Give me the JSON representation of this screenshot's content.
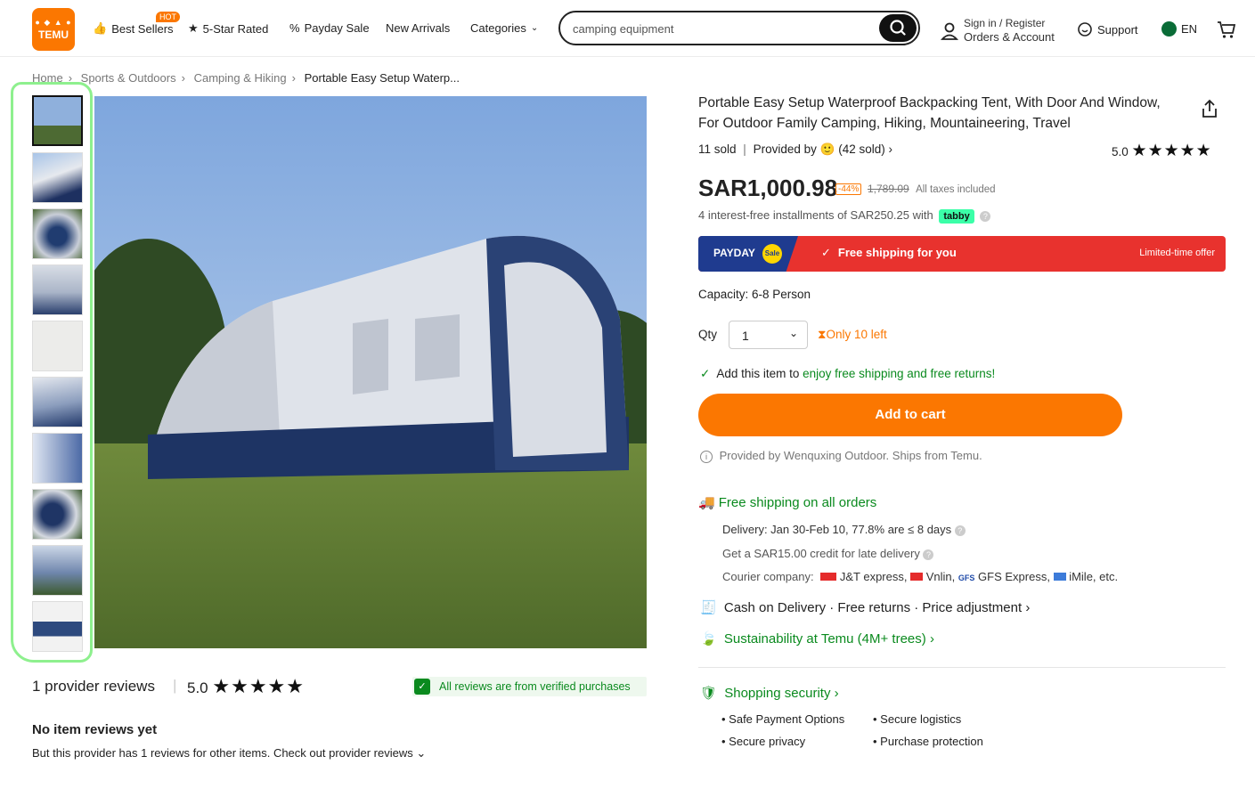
{
  "header": {
    "logo_top": "🛒TEMU",
    "logo_text": "TEMU",
    "hot_badge": "HOT",
    "nav": [
      "Best Sellers",
      "5-Star Rated",
      "Payday Sale",
      "New Arrivals",
      "Categories"
    ],
    "search_value": "camping equipment",
    "signin_line1": "Sign in / Register",
    "signin_line2": "Orders & Account",
    "support": "Support",
    "lang": "EN"
  },
  "breadcrumb": [
    "Home",
    "Sports & Outdoors",
    "Camping & Hiking",
    "Portable Easy Setup Waterp..."
  ],
  "product": {
    "title": "Portable Easy Setup Waterproof Backpacking Tent, With Door And Window, For Outdoor Family Camping, Hiking, Mountaineering, Travel",
    "sold": "11 sold",
    "provided_by": "Provided by",
    "provider_sold": "(42 sold)",
    "rating": "5.0",
    "price": "SAR1,000.98",
    "discount": "-44%",
    "old_price": "1,789.09",
    "taxes": "All taxes included",
    "installments": "4 interest-free installments of SAR250.25 with",
    "tabby": "tabby",
    "payday_label": "PAYDAY",
    "sale_label": "Sale",
    "free_shipping_banner": "Free shipping for you",
    "limited": "Limited-time offer",
    "capacity": "Capacity: 6-8 Person",
    "qty_label": "Qty",
    "qty_value": "1",
    "stock": "Only 10 left",
    "add_note_prefix": "Add this item to",
    "add_note_link": "enjoy free shipping and free returns!",
    "add_to_cart": "Add to cart",
    "provided_note": "Provided by Wenquxing Outdoor. Ships from Temu."
  },
  "shipping": {
    "title": "Free shipping on all orders",
    "delivery": "Delivery: Jan 30-Feb 10, 77.8% are ≤ 8 days",
    "credit": "Get a SAR15.00 credit for late delivery",
    "courier_label": "Courier company:",
    "couriers": [
      "J&T express,",
      "Vnlin,",
      "GFS Express,",
      "iMile, etc."
    ],
    "cod": "Cash on Delivery · Free returns · Price adjustment",
    "sustain": "Sustainability at Temu (4M+ trees)",
    "security_title": "Shopping security",
    "security_items": [
      "Safe Payment Options",
      "Secure logistics",
      "Secure privacy",
      "Purchase protection"
    ]
  },
  "reviews": {
    "count_label": "1 provider reviews",
    "rating": "5.0",
    "verified": "All reviews are from verified purchases",
    "none_title": "No item reviews yet",
    "none_text": "But this provider has 1 reviews for other items. Check out provider reviews"
  },
  "colors": {
    "accent": "#fb7701",
    "green": "#0a8a1e",
    "banner_red": "#e8322e",
    "banner_blue": "#1f3b8f",
    "tabby": "#3bffa8"
  }
}
